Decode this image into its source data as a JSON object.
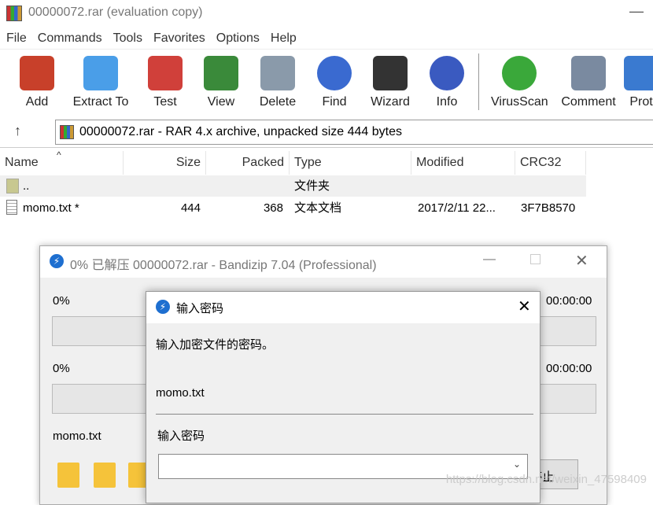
{
  "window": {
    "title": "00000072.rar (evaluation copy)"
  },
  "menu": [
    "File",
    "Commands",
    "Tools",
    "Favorites",
    "Options",
    "Help"
  ],
  "toolbar": [
    {
      "label": "Add",
      "icon": "books-archive-icon",
      "color": "#c8402a"
    },
    {
      "label": "Extract To",
      "icon": "folder-extract-icon",
      "color": "#4a9ee8"
    },
    {
      "label": "Test",
      "icon": "clipboard-check-icon",
      "color": "#d0403a"
    },
    {
      "label": "View",
      "icon": "book-icon",
      "color": "#3a8a3a"
    },
    {
      "label": "Delete",
      "icon": "trash-icon",
      "color": "#8a9aaa"
    },
    {
      "label": "Find",
      "icon": "magnifier-icon",
      "color": "#3a6ad0"
    },
    {
      "label": "Wizard",
      "icon": "magic-wand-icon",
      "color": "#333333"
    },
    {
      "label": "Info",
      "icon": "info-icon",
      "color": "#3a5ac0"
    },
    {
      "label": "VirusScan",
      "icon": "bug-scan-icon",
      "color": "#3aa83a"
    },
    {
      "label": "Comment",
      "icon": "comment-icon",
      "color": "#7a8aa0"
    },
    {
      "label": "Prot",
      "icon": "shield-icon",
      "color": "#3a7ad0"
    }
  ],
  "address": {
    "text": "00000072.rar - RAR 4.x archive, unpacked size 444 bytes"
  },
  "columns": [
    "Name",
    "Size",
    "Packed",
    "Type",
    "Modified",
    "CRC32"
  ],
  "rows": [
    {
      "name": "..",
      "size": "",
      "packed": "",
      "type": "文件夹",
      "modified": "",
      "crc": ""
    },
    {
      "name": "momo.txt *",
      "size": "444",
      "packed": "368",
      "type": "文本文档",
      "modified": "2017/2/11 22...",
      "crc": "3F7B8570"
    }
  ],
  "bandizip": {
    "title": "0% 已解压 00000072.rar - Bandizip 7.04 (Professional)",
    "progress1": "0%",
    "time1": "00:00:00",
    "progress2": "0%",
    "time2": "00:00:00",
    "progress1_value": 0,
    "progress2_value": 0,
    "current_file": "momo.txt",
    "stop_button": "停止"
  },
  "dialog": {
    "title": "输入密码",
    "message": "输入加密文件的密码。",
    "file": "momo.txt",
    "password_label": "输入密码",
    "password_value": ""
  },
  "watermark": "https://blog.csdn.net/weixin_47598409"
}
